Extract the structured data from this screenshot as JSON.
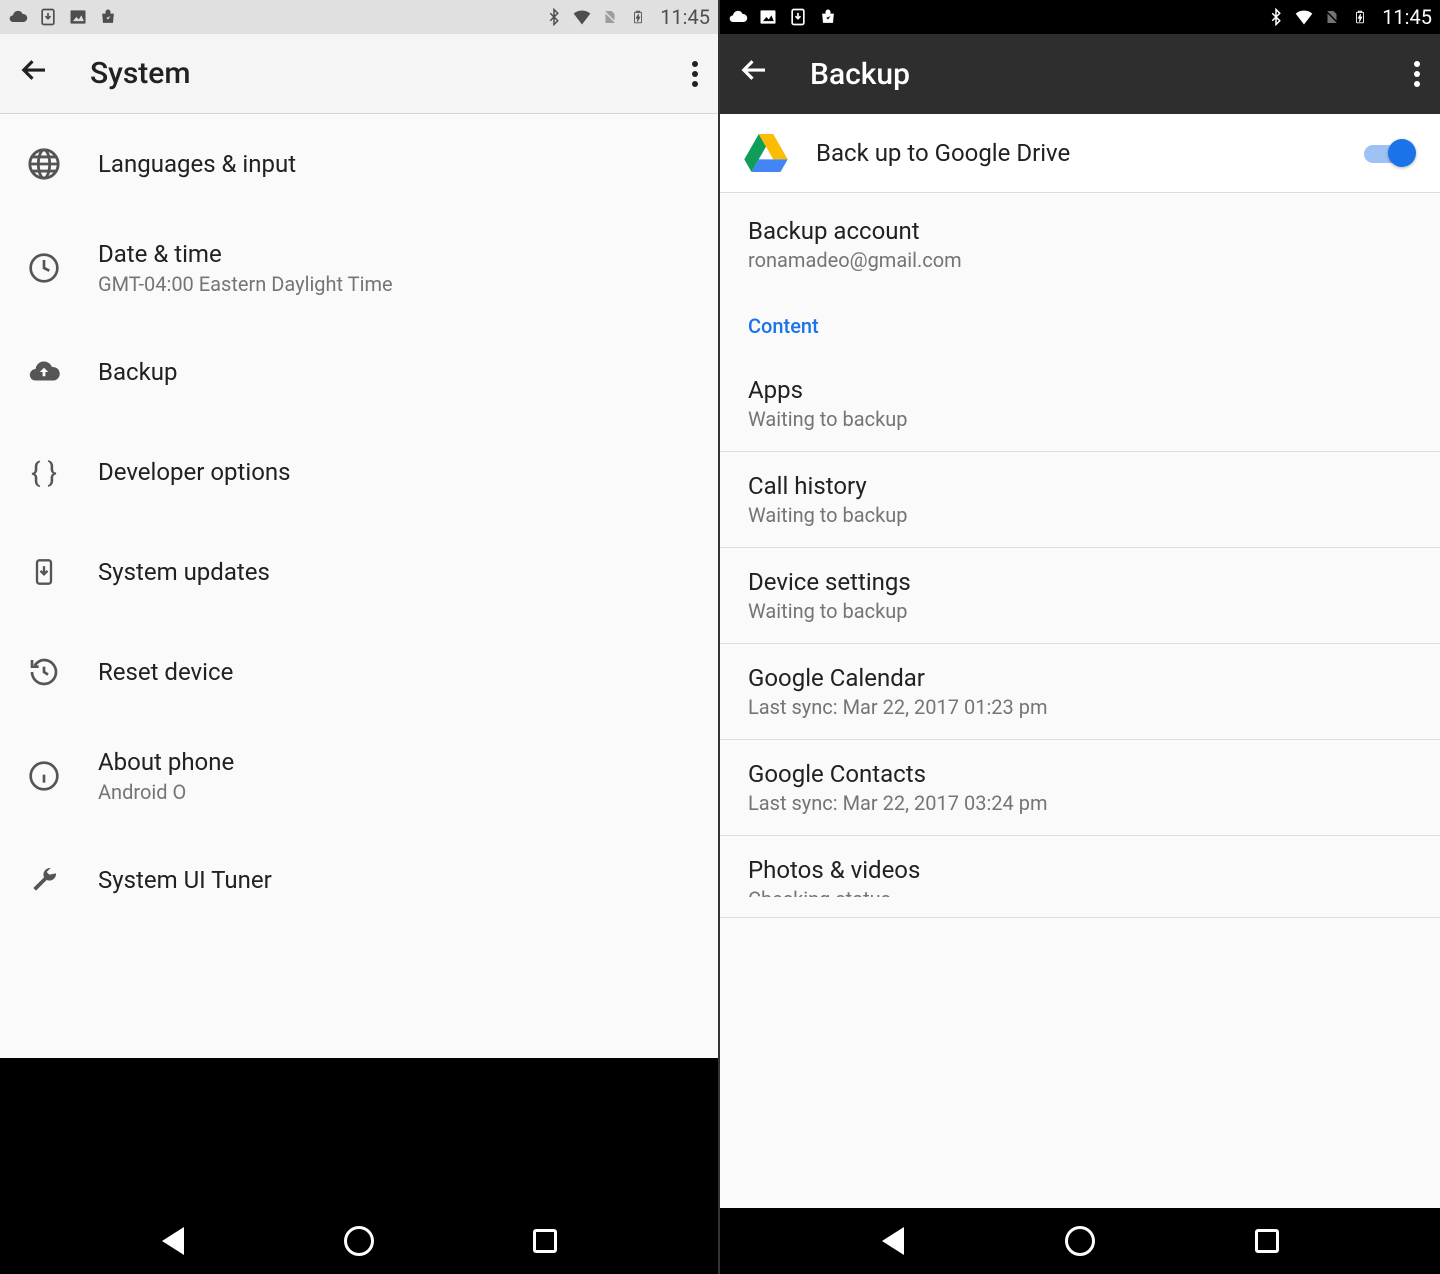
{
  "status": {
    "time": "11:45"
  },
  "left": {
    "title": "System",
    "items": [
      {
        "icon": "globe",
        "title": "Languages & input",
        "sub": ""
      },
      {
        "icon": "clock",
        "title": "Date & time",
        "sub": "GMT-04:00 Eastern Daylight Time"
      },
      {
        "icon": "cloud-up",
        "title": "Backup",
        "sub": ""
      },
      {
        "icon": "braces",
        "title": "Developer options",
        "sub": ""
      },
      {
        "icon": "phone-down",
        "title": "System updates",
        "sub": ""
      },
      {
        "icon": "restore",
        "title": "Reset device",
        "sub": ""
      },
      {
        "icon": "info",
        "title": "About phone",
        "sub": "Android O"
      },
      {
        "icon": "wrench",
        "title": "System UI Tuner",
        "sub": ""
      }
    ]
  },
  "right": {
    "title": "Backup",
    "drive_label": "Back up to Google Drive",
    "drive_on": true,
    "account_label": "Backup account",
    "account_email": "ronamadeo@gmail.com",
    "section": "Content",
    "content": [
      {
        "title": "Apps",
        "sub": "Waiting to backup"
      },
      {
        "title": "Call history",
        "sub": "Waiting to backup"
      },
      {
        "title": "Device settings",
        "sub": "Waiting to backup"
      },
      {
        "title": "Google Calendar",
        "sub": "Last sync: Mar 22, 2017 01:23 pm"
      },
      {
        "title": "Google Contacts",
        "sub": "Last sync: Mar 22, 2017 03:24 pm"
      },
      {
        "title": "Photos & videos",
        "sub": "Checking status"
      }
    ]
  }
}
